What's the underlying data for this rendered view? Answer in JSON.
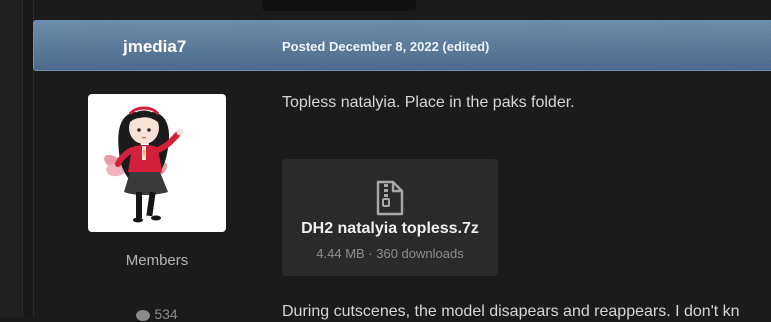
{
  "post": {
    "author": "jmedia7",
    "date_line": "Posted December 8, 2022 (edited)",
    "group": "Members",
    "post_count": "534",
    "body_line_1": "Topless natalyia. Place in the paks folder.",
    "body_line_2": "During cutscenes, the model disapears and reappears. I don't kn",
    "attachment": {
      "icon": "zip-file-icon",
      "name": "DH2 natalyia topless.7z",
      "meta": "4.44 MB · 360 downloads"
    }
  },
  "colors": {
    "page_bg": "#1b1b1b",
    "header_bg": "#5a7b9c",
    "attachment_bg": "#2a2a2a",
    "text": "#d6d6d6",
    "muted": "#8d8d8d"
  }
}
